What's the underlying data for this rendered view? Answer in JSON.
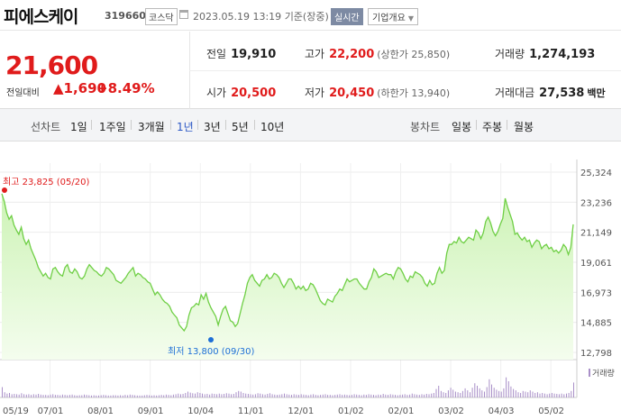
{
  "header": {
    "name": "피에스케이",
    "code": "319660",
    "market": "코스닥",
    "date": "2023.05.19 13:19",
    "basis": "기준(장중)",
    "realtime": "실시간",
    "company_menu": "기업개요"
  },
  "price": {
    "current": "21,600",
    "change_label": "전일대비",
    "change_value": "1,690",
    "change_pct": "+8.49%"
  },
  "stats": {
    "prev_label": "전일",
    "prev": "19,910",
    "open_label": "시가",
    "open": "20,500",
    "high_label": "고가",
    "high": "22,200",
    "upper_limit": "(상한가 25,850)",
    "low_label": "저가",
    "low": "20,450",
    "lower_limit": "(하한가 13,940)",
    "volume_label": "거래량",
    "volume": "1,274,193",
    "amount_label": "거래대금",
    "amount": "27,538",
    "amount_unit": "백만"
  },
  "periods": {
    "line_label": "선차트",
    "line": [
      "1일",
      "1주일",
      "3개월",
      "1년",
      "3년",
      "5년",
      "10년"
    ],
    "active": "1년",
    "candle_label": "봉차트",
    "candle": [
      "일봉",
      "주봉",
      "월봉"
    ]
  },
  "chart_data": {
    "type": "area",
    "price_ticks": [
      "25,324",
      "23,236",
      "21,149",
      "19,061",
      "16,973",
      "14,885",
      "12,798"
    ],
    "ylim": [
      12798,
      25324
    ],
    "x_ticks": [
      "05/19",
      "07/01",
      "08/01",
      "09/01",
      "10/04",
      "11/01",
      "12/01",
      "01/02",
      "02/01",
      "03/02",
      "04/03",
      "05/02"
    ],
    "high_annotation": "최고 23,825 (05/20)",
    "low_annotation": "최저 13,800 (09/30)",
    "volume_legend": "거래량",
    "colors": {
      "line": "#6fcf45",
      "fill_top": "#cdf3b6",
      "fill_bottom": "#f4fdee",
      "high": "#e01b1b",
      "low": "#1d6fd6",
      "volume": "#a98fc8"
    },
    "prices": [
      23825,
      23300,
      22500,
      22050,
      22300,
      21650,
      21300,
      21000,
      21500,
      20700,
      20300,
      20600,
      20000,
      19600,
      19200,
      18700,
      18400,
      18100,
      18300,
      18000,
      17900,
      18600,
      18700,
      18400,
      18200,
      18100,
      18700,
      18900,
      18400,
      18300,
      18600,
      18400,
      18000,
      17900,
      18100,
      18600,
      18900,
      18700,
      18500,
      18400,
      18200,
      18100,
      18300,
      18700,
      18600,
      18400,
      18200,
      17800,
      17700,
      17600,
      17800,
      18000,
      18300,
      18500,
      18700,
      18100,
      18300,
      18200,
      18000,
      17900,
      17700,
      17600,
      17200,
      16800,
      17000,
      16800,
      16500,
      16300,
      16200,
      16000,
      15600,
      15400,
      15200,
      14700,
      14500,
      14300,
      14600,
      15400,
      15900,
      16000,
      16200,
      16100,
      16800,
      16500,
      16900,
      16300,
      15900,
      15600,
      15300,
      14700,
      15300,
      15800,
      16000,
      15500,
      15000,
      14900,
      14600,
      14800,
      15500,
      16200,
      16800,
      17600,
      18000,
      18200,
      17800,
      17600,
      17400,
      17800,
      17900,
      18200,
      17900,
      18000,
      18300,
      18200,
      18000,
      17600,
      17300,
      17600,
      17900,
      17900,
      17600,
      17200,
      17400,
      17200,
      17400,
      17100,
      17200,
      17600,
      17500,
      17200,
      16800,
      16400,
      16200,
      16100,
      16500,
      16400,
      16300,
      16700,
      16900,
      17200,
      17100,
      17500,
      17900,
      17700,
      17800,
      17900,
      17900,
      17600,
      17400,
      17200,
      17200,
      17700,
      18000,
      18600,
      18400,
      18000,
      18100,
      18200,
      18300,
      18200,
      18200,
      17900,
      18400,
      18700,
      18600,
      18300,
      17900,
      17700,
      18100,
      18000,
      18400,
      18300,
      18200,
      18000,
      17600,
      17400,
      17800,
      17500,
      17600,
      18300,
      18700,
      18300,
      18500,
      19700,
      20300,
      20300,
      20500,
      20400,
      20800,
      20500,
      20400,
      20600,
      20800,
      20700,
      20600,
      21300,
      21100,
      20700,
      21100,
      21900,
      22200,
      21800,
      21200,
      20900,
      21200,
      21700,
      22100,
      23500,
      22900,
      22400,
      21900,
      21000,
      21100,
      20800,
      20600,
      20800,
      20500,
      20600,
      20100,
      20400,
      20600,
      20500,
      20000,
      20200,
      20300,
      20000,
      20100,
      19800,
      19900,
      19700,
      19900,
      20300,
      20100,
      19600,
      20100,
      21700
    ],
    "volumes": [
      0.32,
      0.16,
      0.12,
      0.14,
      0.1,
      0.11,
      0.1,
      0.09,
      0.13,
      0.1,
      0.09,
      0.1,
      0.08,
      0.1,
      0.09,
      0.11,
      0.09,
      0.08,
      0.08,
      0.07,
      0.09,
      0.1,
      0.08,
      0.08,
      0.07,
      0.09,
      0.08,
      0.07,
      0.08,
      0.09,
      0.07,
      0.06,
      0.07,
      0.07,
      0.09,
      0.08,
      0.07,
      0.06,
      0.07,
      0.06,
      0.06,
      0.07,
      0.08,
      0.07,
      0.06,
      0.06,
      0.07,
      0.07,
      0.06,
      0.07,
      0.06,
      0.08,
      0.07,
      0.09,
      0.08,
      0.07,
      0.06,
      0.06,
      0.06,
      0.07,
      0.08,
      0.07,
      0.06,
      0.07,
      0.06,
      0.07,
      0.08,
      0.07,
      0.09,
      0.08,
      0.07,
      0.09,
      0.1,
      0.12,
      0.1,
      0.11,
      0.14,
      0.18,
      0.15,
      0.13,
      0.12,
      0.16,
      0.14,
      0.12,
      0.1,
      0.11,
      0.09,
      0.12,
      0.11,
      0.1,
      0.12,
      0.1,
      0.11,
      0.13,
      0.12,
      0.1,
      0.11,
      0.16,
      0.2,
      0.18,
      0.14,
      0.12,
      0.11,
      0.1,
      0.09,
      0.1,
      0.13,
      0.12,
      0.1,
      0.09,
      0.11,
      0.13,
      0.1,
      0.09,
      0.08,
      0.09,
      0.1,
      0.12,
      0.1,
      0.09,
      0.08,
      0.1,
      0.09,
      0.08,
      0.1,
      0.09,
      0.08,
      0.07,
      0.09,
      0.1,
      0.08,
      0.07,
      0.08,
      0.09,
      0.1,
      0.08,
      0.08,
      0.07,
      0.08,
      0.09,
      0.1,
      0.08,
      0.09,
      0.08,
      0.07,
      0.08,
      0.1,
      0.09,
      0.08,
      0.07,
      0.09,
      0.08,
      0.1,
      0.09,
      0.08,
      0.07,
      0.09,
      0.08,
      0.11,
      0.09,
      0.08,
      0.1,
      0.09,
      0.08,
      0.07,
      0.08,
      0.09,
      0.1,
      0.08,
      0.09,
      0.12,
      0.1,
      0.09,
      0.08,
      0.1,
      0.09,
      0.11,
      0.1,
      0.12,
      0.14,
      0.26,
      0.36,
      0.2,
      0.16,
      0.14,
      0.22,
      0.3,
      0.24,
      0.18,
      0.16,
      0.14,
      0.2,
      0.28,
      0.22,
      0.16,
      0.3,
      0.44,
      0.36,
      0.28,
      0.22,
      0.18,
      0.32,
      0.56,
      0.4,
      0.3,
      0.24,
      0.2,
      0.18,
      0.28,
      0.62,
      0.5,
      0.34,
      0.26,
      0.22,
      0.16,
      0.14,
      0.2,
      0.18,
      0.16,
      0.22,
      0.18,
      0.14,
      0.16,
      0.12,
      0.14,
      0.12,
      0.1,
      0.12,
      0.14,
      0.12,
      0.11,
      0.1,
      0.12,
      0.1,
      0.12,
      0.14,
      0.2,
      0.46
    ]
  }
}
